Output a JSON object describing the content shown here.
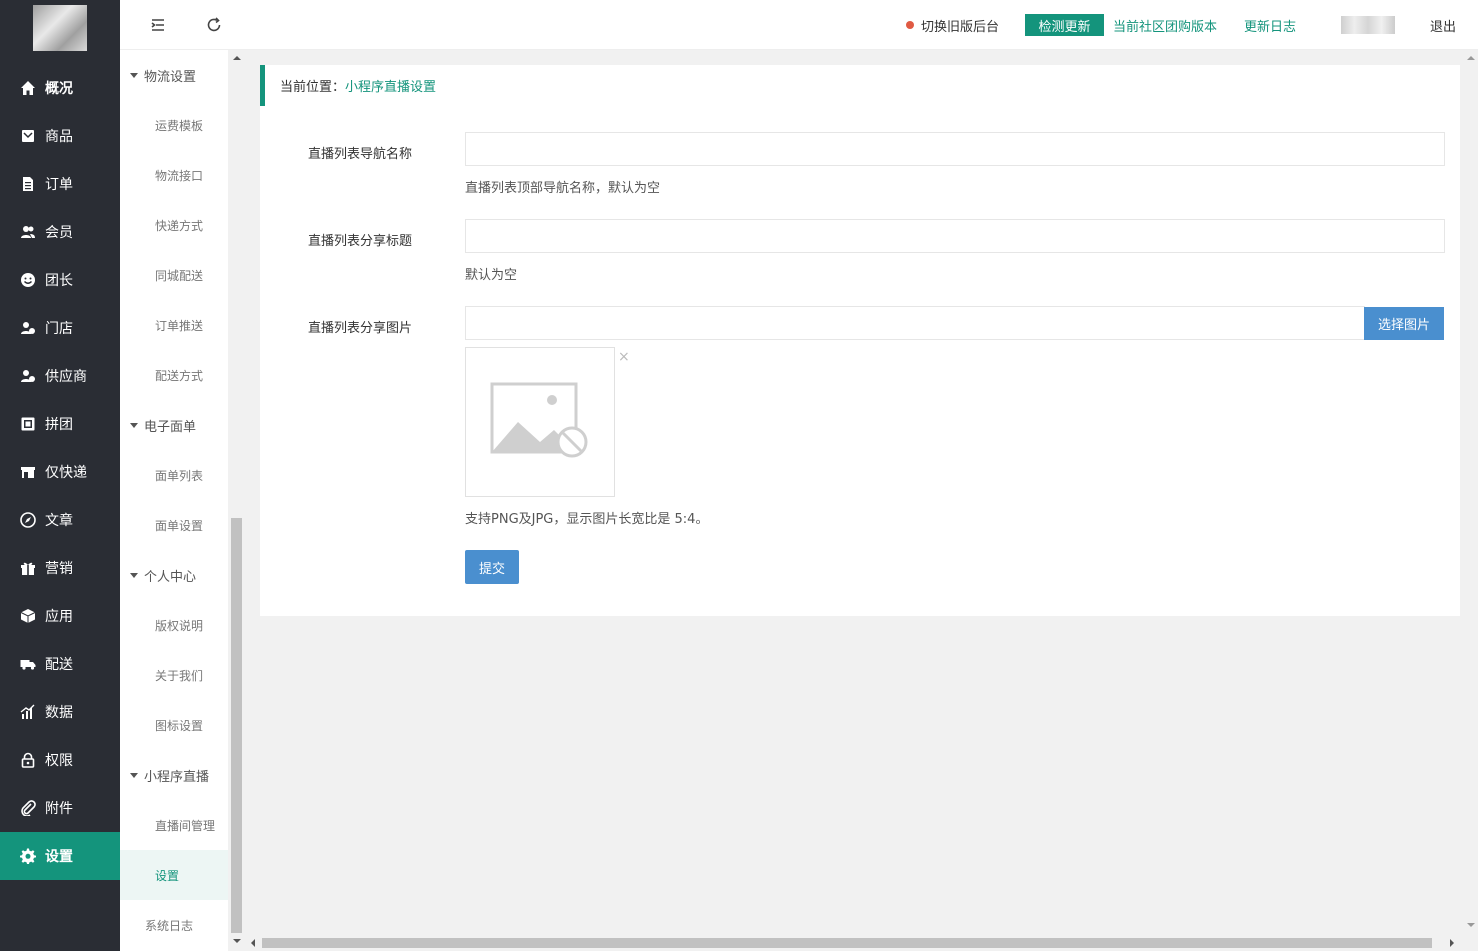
{
  "sidebar": {
    "items": [
      {
        "label": "概况",
        "icon": "home-icon"
      },
      {
        "label": "商品",
        "icon": "goods-icon"
      },
      {
        "label": "订单",
        "icon": "order-icon"
      },
      {
        "label": "会员",
        "icon": "users-icon"
      },
      {
        "label": "团长",
        "icon": "leader-icon"
      },
      {
        "label": "门店",
        "icon": "store-icon"
      },
      {
        "label": "供应商",
        "icon": "supplier-icon"
      },
      {
        "label": "拼团",
        "icon": "group-buy-icon"
      },
      {
        "label": "仅快递",
        "icon": "express-icon"
      },
      {
        "label": "文章",
        "icon": "compass-icon"
      },
      {
        "label": "营销",
        "icon": "gift-icon"
      },
      {
        "label": "应用",
        "icon": "cube-icon"
      },
      {
        "label": "配送",
        "icon": "truck-icon"
      },
      {
        "label": "数据",
        "icon": "chart-icon"
      },
      {
        "label": "权限",
        "icon": "lock-icon"
      },
      {
        "label": "附件",
        "icon": "paperclip-icon"
      },
      {
        "label": "设置",
        "icon": "gear-icon"
      }
    ],
    "active": "设置"
  },
  "subnav": {
    "groups": [
      {
        "title": "物流设置",
        "items": [
          "运费模板",
          "物流接口",
          "快递方式",
          "同城配送",
          "订单推送",
          "配送方式"
        ]
      },
      {
        "title": "电子面单",
        "items": [
          "面单列表",
          "面单设置"
        ]
      },
      {
        "title": "个人中心",
        "items": [
          "版权说明",
          "关于我们",
          "图标设置"
        ]
      },
      {
        "title": "小程序直播",
        "items": [
          "直播间管理",
          "设置"
        ]
      }
    ],
    "extra": "系统日志",
    "active": "设置"
  },
  "header": {
    "switch_label": "切换旧版后台",
    "check_update": "检测更新",
    "version_label": "当前社区团购版本",
    "changelog": "更新日志",
    "logout": "退出",
    "colors": {
      "accent": "#14947c",
      "dot": "#e05a43",
      "link": "#14947c"
    }
  },
  "breadcrumb": {
    "prefix": "当前位置：",
    "current": "小程序直播设置"
  },
  "form": {
    "nav_name_label": "直播列表导航名称",
    "nav_name_value": "",
    "nav_name_help": "直播列表顶部导航名称，默认为空",
    "share_title_label": "直播列表分享标题",
    "share_title_value": "",
    "share_title_help": "默认为空",
    "share_image_label": "直播列表分享图片",
    "share_image_value": "",
    "choose_image": "选择图片",
    "close_symbol": "×",
    "image_help": "支持PNG及JPG，显示图片长宽比是 5:4。",
    "submit": "提交"
  }
}
